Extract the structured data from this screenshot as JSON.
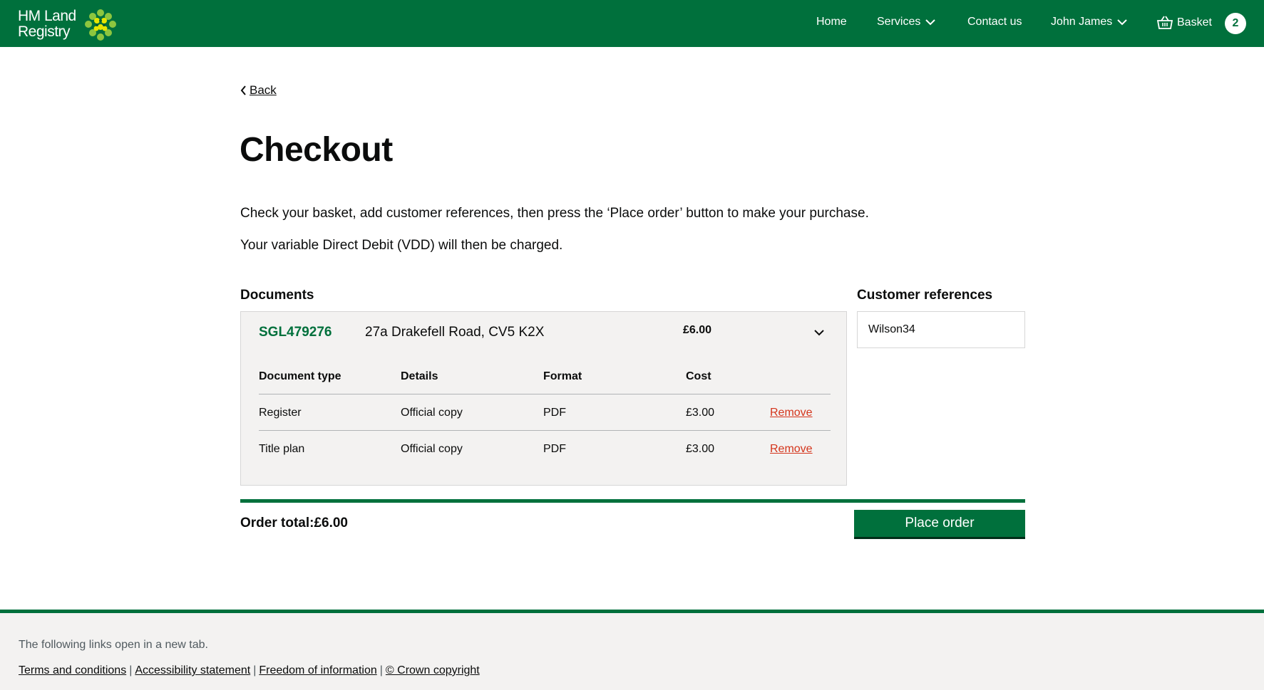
{
  "header": {
    "logo_line1": "HM Land",
    "logo_line2": "Registry",
    "logo_icon": "hmlr-crest-icon",
    "nav": {
      "home": "Home",
      "services": "Services",
      "contact": "Contact us",
      "user": "John James",
      "basket": "Basket",
      "basket_count": "2"
    }
  },
  "back_label": "Back",
  "page_title": "Checkout",
  "intro": {
    "line1": "Check your basket, add customer references, then press the ‘Place order’ button to make your purchase.",
    "line2": "Your variable Direct Debit (VDD) will then be charged."
  },
  "documents": {
    "heading": "Documents",
    "title_number": "SGL479276",
    "address": "27a Drakefell Road, CV5 K2X",
    "total": "£6.00",
    "columns": [
      "Document type",
      "Details",
      "Format",
      "Cost"
    ],
    "rows": [
      {
        "type": "Register",
        "details": "Official copy",
        "format": "PDF",
        "cost": "£3.00",
        "action": "Remove"
      },
      {
        "type": "Title plan",
        "details": "Official copy",
        "format": "PDF",
        "cost": "£3.00",
        "action": "Remove"
      }
    ]
  },
  "customer_references": {
    "heading": "Customer references",
    "value": "Wilson34"
  },
  "order": {
    "total_label": "Order total:",
    "total_value": "£6.00",
    "place_order": "Place order"
  },
  "footer": {
    "note": "The following links open in a new tab.",
    "links": [
      "Terms and conditions",
      "Accessibility statement",
      "Freedom of information",
      "© Crown copyright"
    ],
    "separator": "|"
  },
  "colors": {
    "brand_green": "#00703c",
    "remove_red": "#d4351c",
    "panel_grey": "#f3f2f1"
  }
}
